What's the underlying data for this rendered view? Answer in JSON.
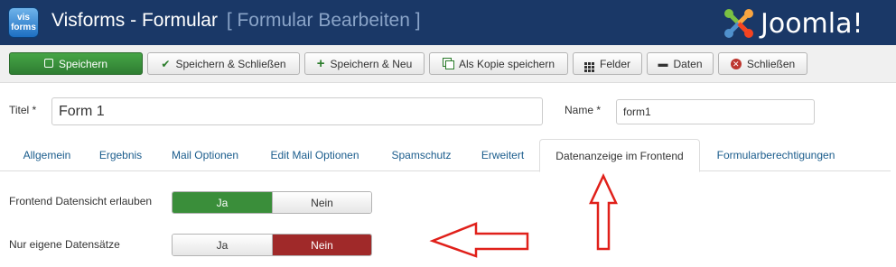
{
  "header": {
    "app_icon_text": [
      "vis",
      "forms"
    ],
    "title": "Visforms - Formular",
    "subtitle": "[ Formular Bearbeiten ]",
    "brand": "Joomla!",
    "colors": {
      "bar": "#1a3867",
      "subtitle": "#8aa4c8"
    }
  },
  "toolbar": {
    "buttons": [
      {
        "label": "Speichern",
        "icon": "edit-icon"
      },
      {
        "label": "Speichern & Schließen",
        "icon": "check-icon"
      },
      {
        "label": "Speichern & Neu",
        "icon": "plus-icon"
      },
      {
        "label": "Als Kopie speichern",
        "icon": "copy-icon"
      },
      {
        "label": "Felder",
        "icon": "grid-icon"
      },
      {
        "label": "Daten",
        "icon": "data-icon"
      },
      {
        "label": "Schließen",
        "icon": "close-circle-icon"
      }
    ]
  },
  "form": {
    "title_label": "Titel *",
    "title_value": "Form 1",
    "name_label": "Name *",
    "name_value": "form1"
  },
  "tabs": [
    {
      "label": "Allgemein"
    },
    {
      "label": "Ergebnis"
    },
    {
      "label": "Mail Optionen"
    },
    {
      "label": "Edit Mail Optionen"
    },
    {
      "label": "Spamschutz"
    },
    {
      "label": "Erweitert"
    },
    {
      "label": "Datenanzeige im Frontend",
      "active": true
    },
    {
      "label": "Formularberechtigungen"
    }
  ],
  "settings": [
    {
      "label": "Frontend Datensicht erlauben",
      "yes": "Ja",
      "no": "Nein",
      "selected": "Ja"
    },
    {
      "label": "Nur eigene Datensätze",
      "yes": "Ja",
      "no": "Nein",
      "selected": "Nein"
    }
  ],
  "annotation_color": "#e0201a"
}
